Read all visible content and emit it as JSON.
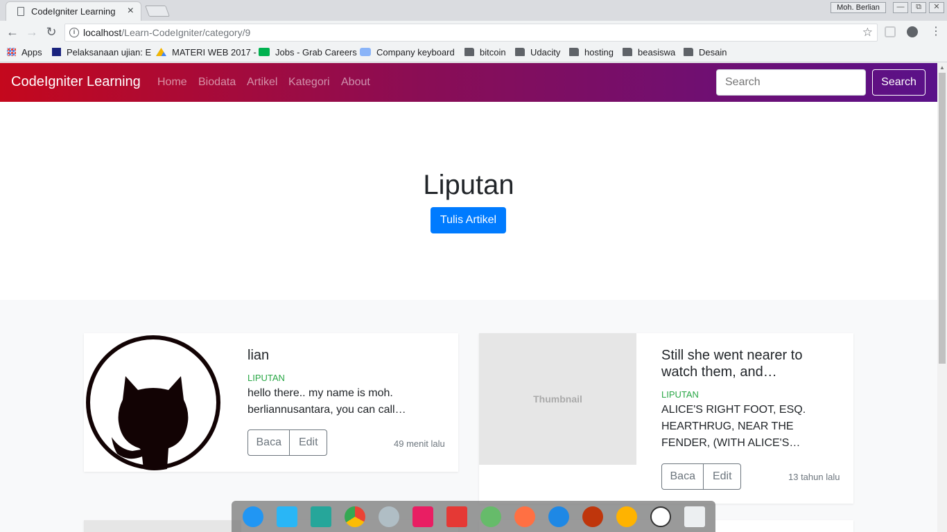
{
  "browser": {
    "tab_title": "CodeIgniter Learning",
    "tab_close": "×",
    "user": "Moh. Berlian",
    "window_buttons": [
      "—",
      "⧉",
      "✕"
    ],
    "url_host": "localhost",
    "url_path": "/Learn-CodeIgniter/category/9",
    "bookmarks": [
      {
        "label": "Apps",
        "icon": "apps-grid-icon"
      },
      {
        "label": "Pelaksanaan ujian: E",
        "icon": "te-icon"
      },
      {
        "label": "MATERI WEB 2017 -",
        "icon": "drive-icon"
      },
      {
        "label": "Jobs - Grab Careers",
        "icon": "grab-icon"
      },
      {
        "label": "Company keyboard",
        "icon": "cloud-icon"
      },
      {
        "label": "bitcoin",
        "icon": "folder-icon"
      },
      {
        "label": "Udacity",
        "icon": "folder-icon"
      },
      {
        "label": "hosting",
        "icon": "folder-icon"
      },
      {
        "label": "beasiswa",
        "icon": "folder-icon"
      },
      {
        "label": "Desain",
        "icon": "folder-icon"
      }
    ]
  },
  "site": {
    "brand": "CodeIgniter Learning",
    "nav": [
      "Home",
      "Biodata",
      "Artikel",
      "Kategori",
      "About"
    ],
    "search_placeholder": "Search",
    "search_button": "Search"
  },
  "hero": {
    "title": "Liputan",
    "button": "Tulis Artikel"
  },
  "articles": [
    {
      "title": "lian",
      "category": "LIPUTAN",
      "excerpt": "hello there.. my name is moh. berliannusantara, you can call…",
      "read": "Baca",
      "edit": "Edit",
      "time": "49 menit lalu",
      "image": "github-octocat-icon"
    },
    {
      "title": "Still she went nearer to watch them, and…",
      "category": "LIPUTAN",
      "excerpt": "ALICE'S RIGHT FOOT, ESQ. HEARTHRUG, NEAR THE FENDER, (WITH ALICE'S…",
      "read": "Baca",
      "edit": "Edit",
      "time": "13 tahun lalu",
      "thumbnail_label": "Thumbnail"
    }
  ],
  "colors": {
    "nav_gradient_start": "#c4081d",
    "nav_gradient_end": "#5a1189",
    "primary": "#007bff",
    "category": "#28a745"
  }
}
